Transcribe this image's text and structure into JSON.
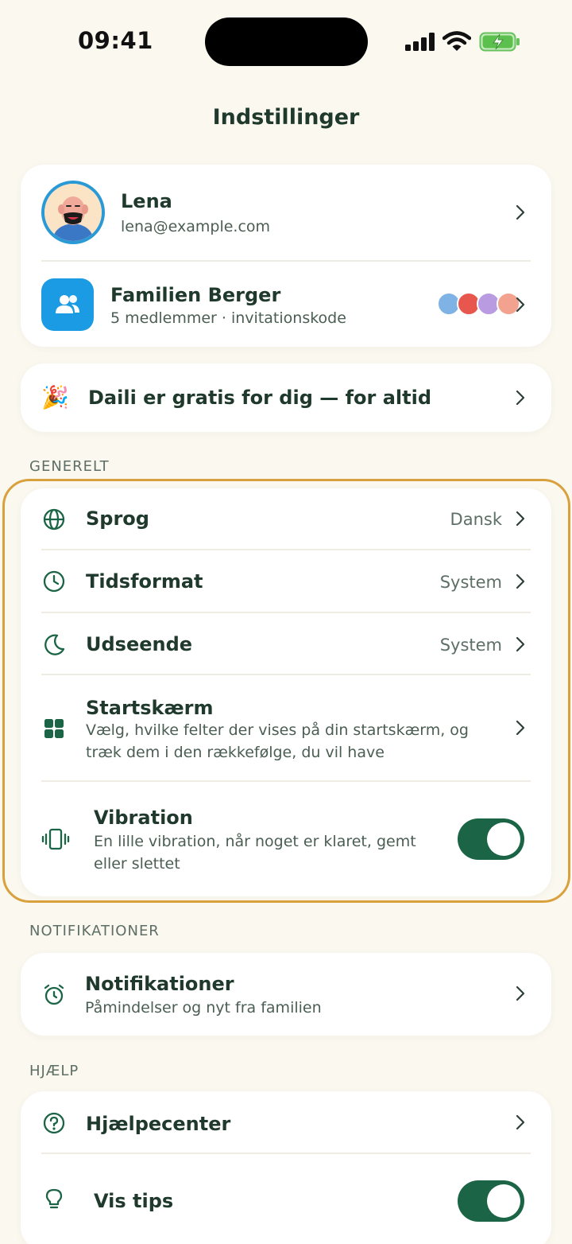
{
  "status_bar": {
    "time": "09:41"
  },
  "page": {
    "title": "Indstillinger"
  },
  "profile": {
    "name": "Lena",
    "email": "lena@example.com",
    "family_name": "Familien Berger",
    "family_sub": "5 medlemmer · invitationskode"
  },
  "promo": {
    "emoji": "🎉",
    "text": "Daili er gratis for dig — for altid"
  },
  "general": {
    "label": "GENERELT",
    "language": {
      "label": "Sprog",
      "value": "Dansk",
      "icon": "globe-icon"
    },
    "time_format": {
      "label": "Tidsformat",
      "value": "System",
      "icon": "clock-icon"
    },
    "appearance": {
      "label": "Udseende",
      "value": "System",
      "icon": "moon-icon"
    },
    "start_screen": {
      "label": "Startskærm",
      "desc": "Vælg, hvilke felter der vises på din startskærm, og træk dem i den rækkefølge, du vil have",
      "icon": "grid-icon"
    },
    "vibration": {
      "label": "Vibration",
      "desc": "En lille vibration, når noget er klaret, gemt eller slettet",
      "icon": "vibration-icon",
      "enabled": true
    }
  },
  "notifications": {
    "label": "NOTIFIKATIONER",
    "item": {
      "label": "Notifikationer",
      "desc": "Påmindelser og nyt fra familien",
      "icon": "alarm-icon"
    }
  },
  "help": {
    "label": "HJÆLP",
    "help_center": {
      "label": "Hjælpecenter",
      "icon": "question-icon"
    },
    "tips": {
      "label": "Vis tips",
      "icon": "lightbulb-icon",
      "enabled": true
    }
  },
  "colors": {
    "accent": "#1b6446",
    "highlight": "#d9a13e",
    "family_icon": "#1a9be3",
    "background": "#fbf8ef"
  }
}
